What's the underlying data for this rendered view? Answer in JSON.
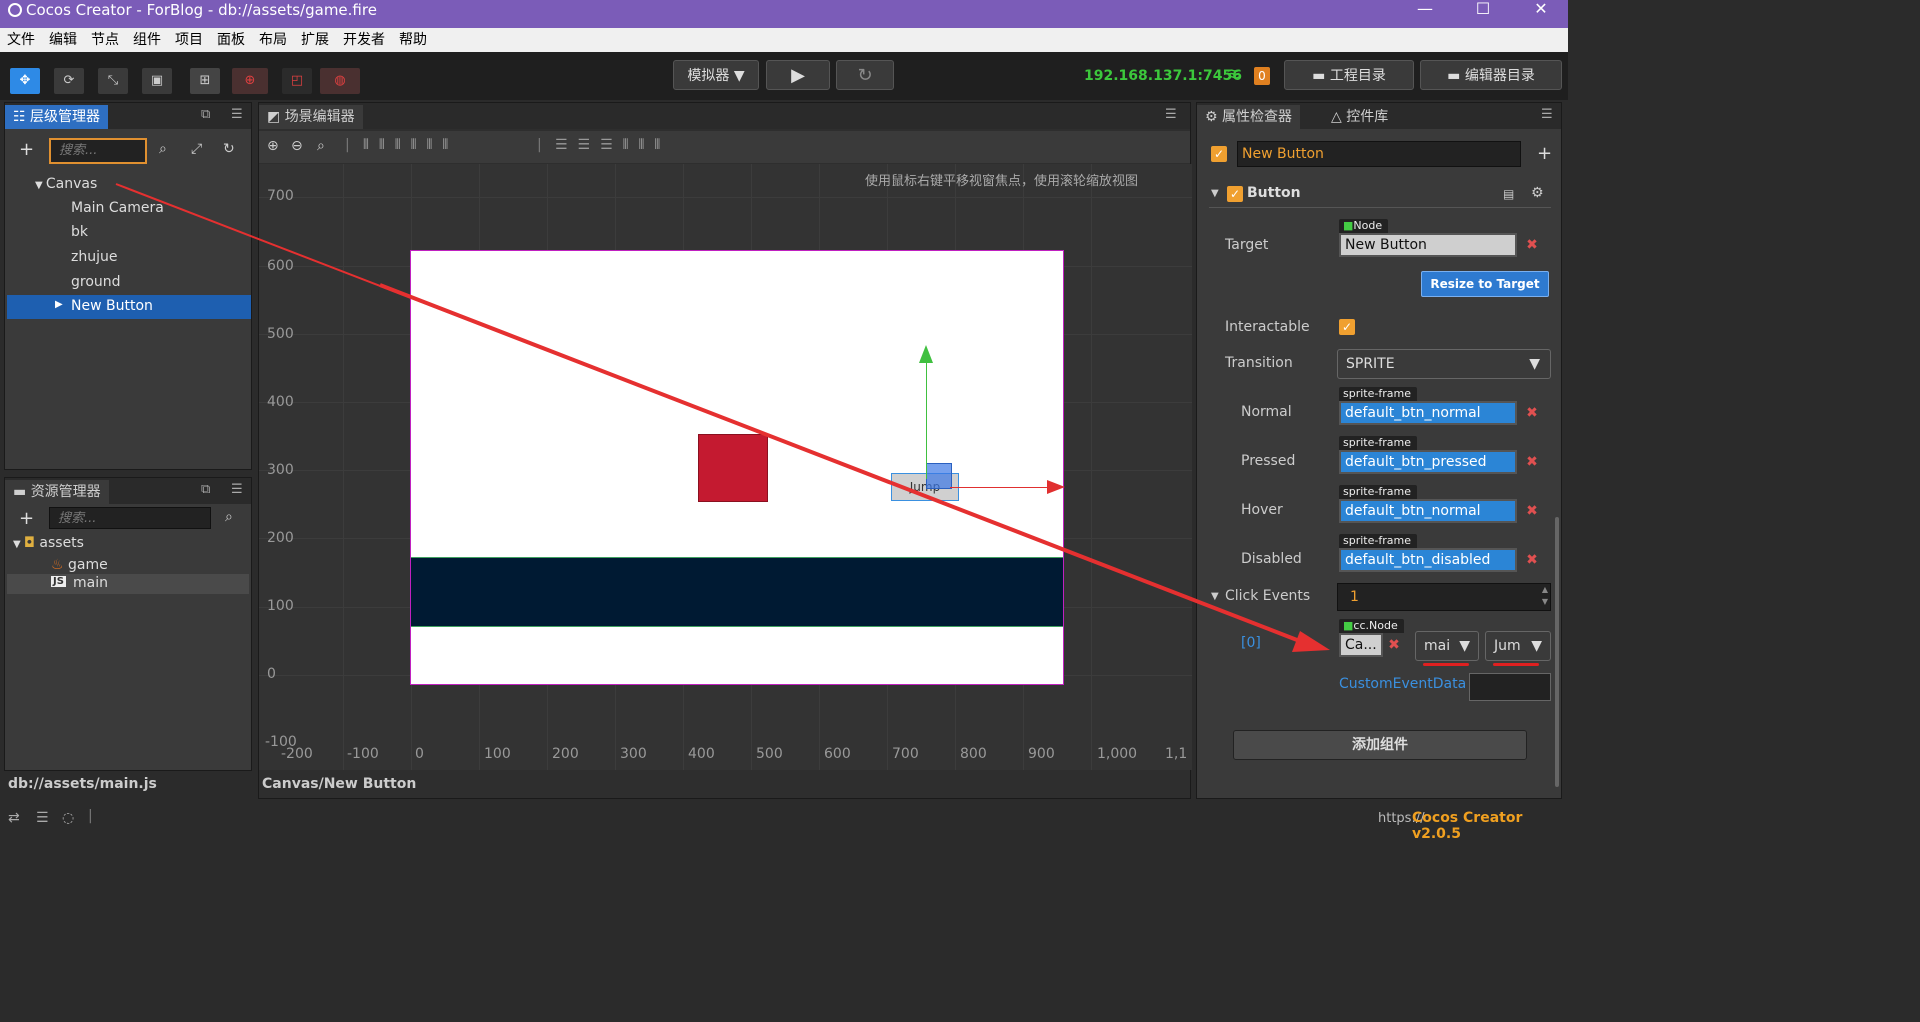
{
  "window": {
    "title": "Cocos Creator - ForBlog - db://assets/game.fire",
    "controls": [
      "—",
      "☐",
      "✕"
    ]
  },
  "menu": [
    "文件",
    "编辑",
    "节点",
    "组件",
    "项目",
    "面板",
    "布局",
    "扩展",
    "开发者",
    "帮助"
  ],
  "toolbar": {
    "simulator_label": "模拟器 ▼",
    "ip_address": "192.168.137.1:7456",
    "badge_count": "0",
    "project_dir": "工程目录",
    "editor_dir": "编辑器目录"
  },
  "hierarchy": {
    "tab": "层级管理器",
    "search_placeholder": "搜索...",
    "root": "Canvas",
    "children": [
      "Main Camera",
      "bk",
      "zhujue",
      "ground"
    ],
    "selected": "New Button"
  },
  "assets": {
    "tab": "资源管理器",
    "search_placeholder": "搜索...",
    "root": "assets",
    "items": [
      "game",
      "main"
    ],
    "footer_path": "db://assets/main.js"
  },
  "scene": {
    "tab": "场景编辑器",
    "hint": "使用鼠标右键平移视窗焦点，使用滚轮缩放视图",
    "y_ticks": [
      "700",
      "600",
      "500",
      "400",
      "300",
      "200",
      "100",
      "0",
      "-100"
    ],
    "x_ticks": [
      "-200",
      "-100",
      "0",
      "100",
      "200",
      "300",
      "400",
      "500",
      "600",
      "700",
      "800",
      "900",
      "1,000",
      "1,1"
    ],
    "button_text": "Jump",
    "footer_path": "Canvas/New Button",
    "colors": {
      "canvas": "#ffffff",
      "block": "#c41a30",
      "ground": "#001a33",
      "canvas_border": "#c020c0",
      "arrow_red": "#e53030"
    }
  },
  "inspector": {
    "tab": "属性检查器",
    "tab2": "控件库",
    "node_name": "New Button",
    "component": "Button",
    "target_label": "Target",
    "target_tag": "Node",
    "target_value": "New Button",
    "resize_btn": "Resize to Target",
    "interactable_label": "Interactable",
    "transition_label": "Transition",
    "transition_value": "SPRITE",
    "normal_label": "Normal",
    "normal_value": "default_btn_normal",
    "pressed_label": "Pressed",
    "pressed_value": "default_btn_pressed",
    "hover_label": "Hover",
    "hover_value": "default_btn_normal",
    "disabled_label": "Disabled",
    "disabled_value": "default_btn_disabled",
    "sprite_tag": "sprite-frame",
    "click_events_label": "Click Events",
    "click_events_count": "1",
    "event_index": "[0]",
    "ccnode_tag": "cc.Node",
    "event_target": "Ca...",
    "event_component": "mai",
    "event_handler": "Jum",
    "custom_event_label": "CustomEventData",
    "add_component": "添加组件"
  },
  "statusbar": {
    "url": "https://",
    "version": "Cocos Creator v2.0.5"
  }
}
